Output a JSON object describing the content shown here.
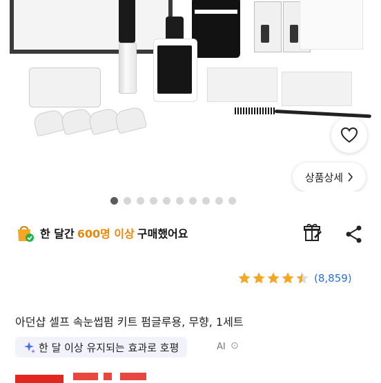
{
  "hero": {
    "detail_button_label": "상품상세",
    "carousel_total": 10,
    "carousel_active": 1
  },
  "promo": {
    "prefix": "한 달간",
    "highlight": "600명 이상",
    "suffix": "구매했어요",
    "highlight_color": "#e8890c",
    "icon": "shopping-bag-check-icon"
  },
  "rating": {
    "stars": 4.5,
    "count": "(8,859)",
    "star_color": "#f5a623"
  },
  "product": {
    "title": "아던샵 셀프 속눈썹펌 키트 펌글루용, 무향, 1세트"
  },
  "ai_summary": {
    "text": "한 달 이상 유지되는 효과로 호평",
    "tag": "AI",
    "more": "⊙"
  },
  "colors": {
    "link_blue": "#2b6fd6",
    "ai_bg": "#f1f3fa"
  }
}
